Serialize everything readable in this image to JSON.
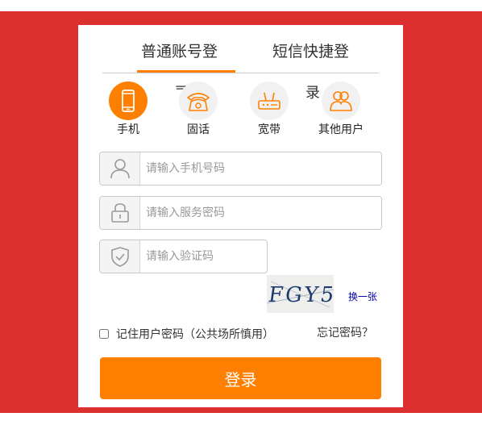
{
  "tabs": {
    "tab1": "普通账号登",
    "tab2": "短信快捷登"
  },
  "partial_chars": {
    "left": "录",
    "right": "录"
  },
  "account_types": [
    {
      "label": "手机",
      "icon": "mobile-phone-icon",
      "active": true
    },
    {
      "label": "固话",
      "icon": "landline-phone-icon",
      "active": false
    },
    {
      "label": "宽带",
      "icon": "router-icon",
      "active": false
    },
    {
      "label": "其他用户",
      "icon": "users-icon",
      "active": false
    }
  ],
  "form": {
    "phone_placeholder": "请输入手机号码",
    "password_placeholder": "请输入服务密码",
    "captcha_placeholder": "请输入验证码"
  },
  "captcha": {
    "text": "FGY5",
    "change_label": "换一张"
  },
  "remember_label": "记住用户密码（公共场所慎用）",
  "forgot_label": "忘记密码？",
  "login_label": "登录",
  "colors": {
    "accent": "#ff8000",
    "background": "#dc2f2f",
    "link": "#0000aa"
  }
}
